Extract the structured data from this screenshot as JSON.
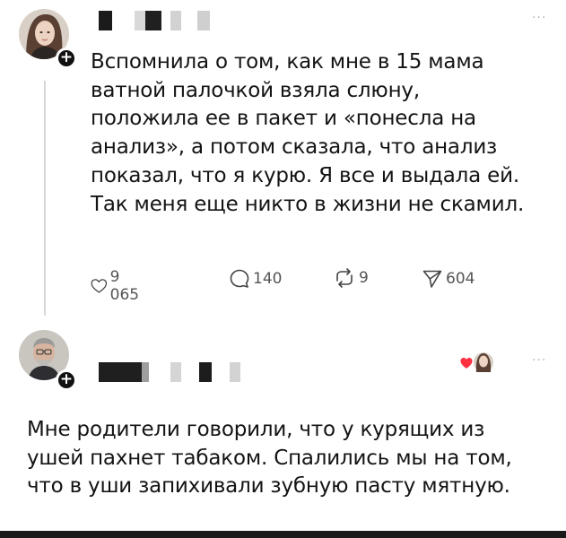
{
  "post1": {
    "text_lines": [
      "Вспомнила о том, как мне в 15 мама",
      "ватной палочкой взяла слюну,",
      "положила ее в пакет и «понесла на",
      "анализ», а потом сказала, что анализ",
      "показал, что я курю. Я все и выдала ей.",
      "Так меня еще никто в жизни не скамил."
    ],
    "more_label": "···",
    "actions": {
      "likes": "9 065",
      "comments": "140",
      "reposts": "9",
      "shares": "604"
    }
  },
  "post2": {
    "text_lines": [
      "Мне родители говорили, что у курящих из",
      "ушей пахнет табаком. Спалились мы на том,",
      "что в уши запихивали зубную пасту мятную."
    ],
    "more_label": "···"
  },
  "icons": {
    "follow": "plus-icon",
    "like": "heart-icon",
    "comment": "comment-icon",
    "repost": "repost-icon",
    "share": "send-icon",
    "more": "more-dots-icon"
  }
}
